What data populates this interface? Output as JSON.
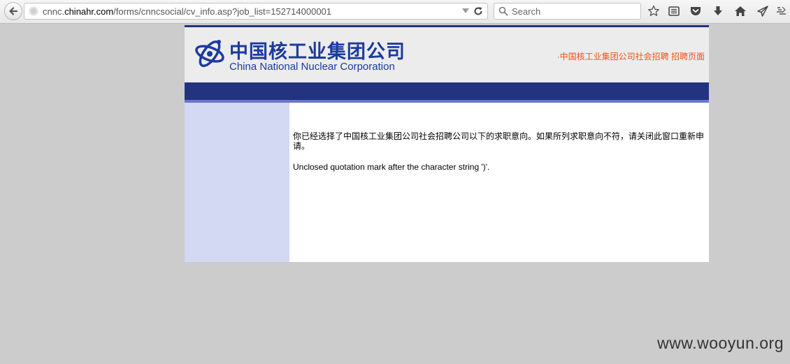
{
  "browser": {
    "url_prefix": "cnnc.",
    "url_domain": "chinahr.com",
    "url_path": "/forms/cnncsocial/cv_info.asp?job_list=152714000001",
    "search_placeholder": "Search"
  },
  "header": {
    "logo_cn": "中国核工业集团公司",
    "logo_en": "China National Nuclear Corporation",
    "link_text": "·中国核工业集团公司社会招聘 招聘页面"
  },
  "content": {
    "message_cn": "你已经选择了中国核工业集团公司社会招聘公司以下的求职意向。如果所列求职意向不符，请关闭此窗口重新申请。",
    "error_text": "Unclosed quotation mark after the character string ')'."
  },
  "watermark": "www.wooyun.org",
  "colors": {
    "brand_blue": "#233380",
    "logo_blue": "#1c3a9e",
    "sidebar": "#d3d8f3",
    "link_orange": "#e8541c"
  },
  "icons": [
    "back-icon",
    "site-icon",
    "dropdown-arrow-icon",
    "reload-icon",
    "search-icon",
    "bookmark-star-icon",
    "reading-list-icon",
    "pocket-icon",
    "download-icon",
    "home-icon",
    "send-icon",
    "extension-icon"
  ]
}
